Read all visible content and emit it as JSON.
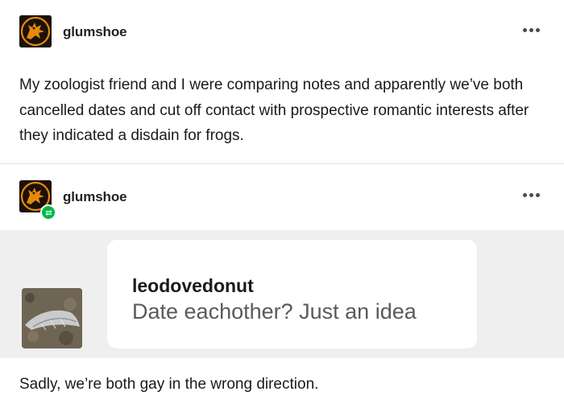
{
  "post": {
    "username": "glumshoe",
    "text": "My zoologist friend and I were comparing notes and apparently we’ve both cancelled dates and cut off contact with prospective romantic interests after they indicated a disdain for frogs."
  },
  "reblog": {
    "username": "glumshoe",
    "ask": {
      "asker": "leodovedonut",
      "question": "Date eachother? Just an idea"
    },
    "answer": "Sadly, we’re both gay in the wrong direction."
  },
  "icons": {
    "avatar": "griffin-avatar-icon",
    "more": "more-options-icon",
    "reblog": "reblog-icon"
  },
  "colors": {
    "reblog_badge": "#00b84a",
    "avatar_orange": "#e8890c",
    "ask_background": "#efefef"
  }
}
